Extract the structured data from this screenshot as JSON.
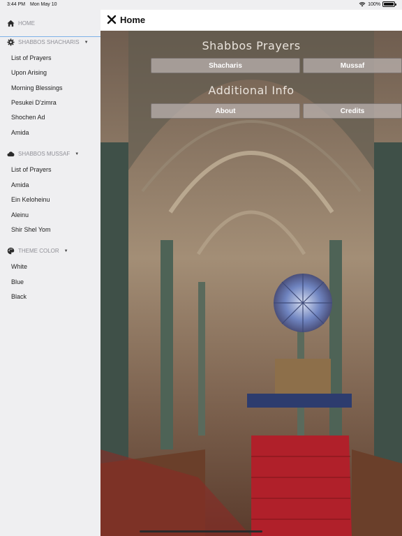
{
  "status": {
    "time": "3:44 PM",
    "date": "Mon May 10",
    "battery": "100%"
  },
  "header": {
    "title": "Home"
  },
  "sidebar": {
    "home_label": "HOME",
    "shacharis": {
      "label": "SHABBOS SHACHARIS",
      "items": [
        "List of Prayers",
        "Upon Arising",
        "Morning Blessings",
        "Pesukei D'zimra",
        "Shochen Ad",
        "Amida"
      ]
    },
    "mussaf": {
      "label": "SHABBOS MUSSAF",
      "items": [
        "List of Prayers",
        "Amida",
        "Ein Keloheinu",
        "Aleinu",
        "Shir Shel Yom"
      ]
    },
    "theme": {
      "label": "THEME COLOR",
      "items": [
        "White",
        "Blue",
        "Black"
      ]
    }
  },
  "main": {
    "prayers_title": "Shabbos Prayers",
    "shacharis_btn": "Shacharis",
    "mussaf_btn": "Mussaf",
    "info_title": "Additional Info",
    "about_btn": "About",
    "credits_btn": "Credits"
  },
  "icons": [
    "home-icon",
    "gear-icon",
    "cloud-icon",
    "palette-icon",
    "close-icon",
    "wifi-icon",
    "battery-icon"
  ]
}
